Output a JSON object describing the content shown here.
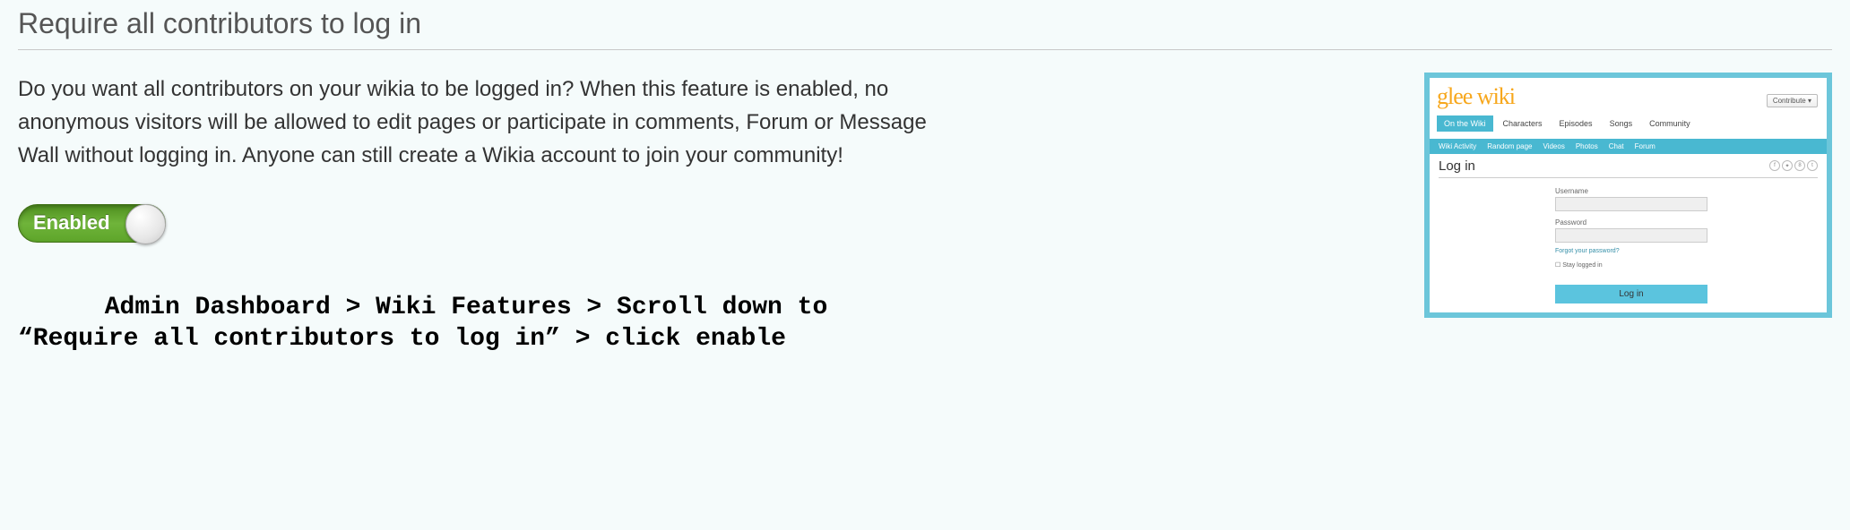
{
  "header": {
    "title": "Require all contributors to log in"
  },
  "description": "Do you want all contributors on your wikia to be logged in? When this feature is enabled, no anonymous visitors will be allowed to edit pages or participate in comments, Forum or Message Wall without logging in. Anyone can still create a Wikia account to join your community!",
  "toggle": {
    "label": "Enabled",
    "state": true
  },
  "help_line1": "Admin Dashboard > Wiki Features > Scroll down to",
  "help_line2": "“Require all contributors to log in” > click enable",
  "preview": {
    "logo": "glee wiki",
    "contribute": "Contribute",
    "tabs": [
      "On the Wiki",
      "Characters",
      "Episodes",
      "Songs",
      "Community"
    ],
    "subnav": [
      "Wiki Activity",
      "Random page",
      "Videos",
      "Photos",
      "Chat",
      "Forum"
    ],
    "login_title": "Log in",
    "username_label": "Username",
    "password_label": "Password",
    "forgot": "Forgot your password?",
    "stay": "Stay logged in",
    "button": "Log in"
  }
}
